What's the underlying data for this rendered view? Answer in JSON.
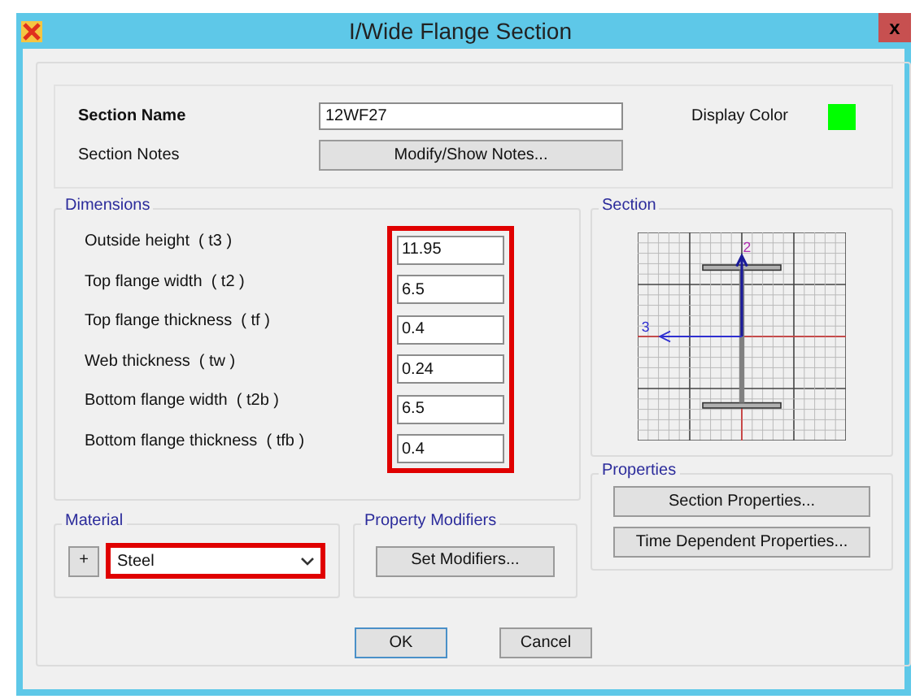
{
  "window": {
    "title": "I/Wide Flange Section",
    "close": "x"
  },
  "section_name": {
    "label": "Section Name",
    "value": "12WF27"
  },
  "display_color": {
    "label": "Display Color",
    "color": "#00ff00"
  },
  "section_notes": {
    "label": "Section Notes",
    "button": "Modify/Show Notes..."
  },
  "dimensions": {
    "title": "Dimensions",
    "highlighted": true,
    "fields": [
      {
        "label": "Outside height  ( t3 )",
        "value": "11.95"
      },
      {
        "label": "Top flange width  ( t2 )",
        "value": "6.5"
      },
      {
        "label": "Top flange thickness  ( tf )",
        "value": "0.4"
      },
      {
        "label": "Web thickness  ( tw )",
        "value": "0.24"
      },
      {
        "label": "Bottom flange width  ( t2b )",
        "value": "6.5"
      },
      {
        "label": "Bottom flange thickness  ( tfb )",
        "value": "0.4"
      }
    ]
  },
  "section": {
    "title": "Section",
    "axis_vertical": "2",
    "axis_horizontal": "3"
  },
  "properties": {
    "title": "Properties",
    "buttons": [
      "Section Properties...",
      "Time Dependent Properties..."
    ]
  },
  "material": {
    "title": "Material",
    "add": "+",
    "value": "Steel",
    "highlighted": true
  },
  "property_modifiers": {
    "title": "Property Modifiers",
    "button": "Set Modifiers..."
  },
  "buttons": [
    {
      "label": "OK",
      "default": true
    },
    {
      "label": "Cancel",
      "default": false
    }
  ]
}
